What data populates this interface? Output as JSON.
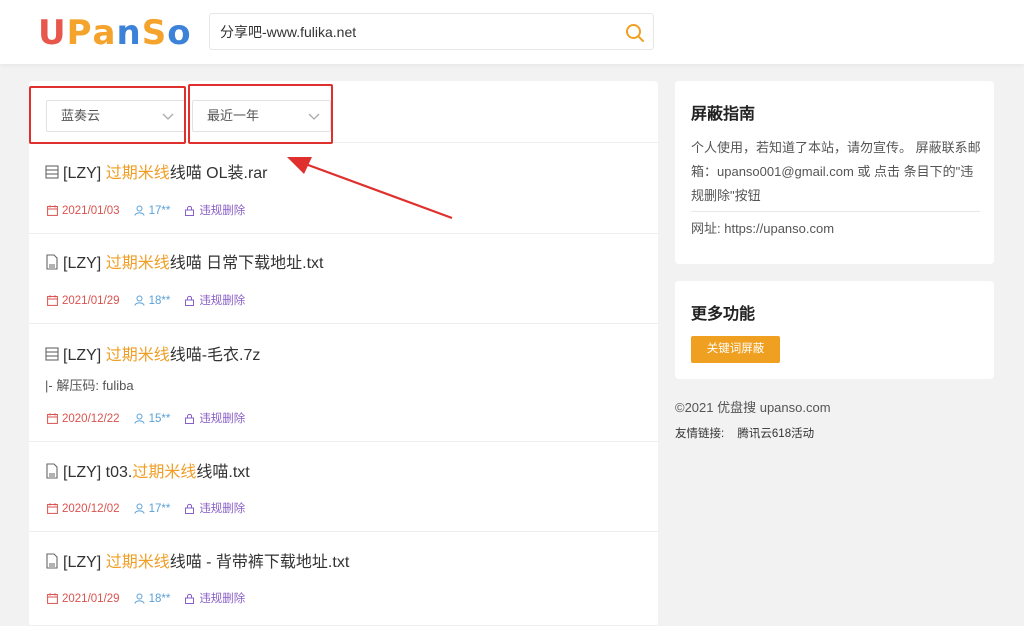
{
  "header": {
    "logo": [
      {
        "ch": "U",
        "color": "#e8574c"
      },
      {
        "ch": "P",
        "color": "#f4a32c"
      },
      {
        "ch": "a",
        "color": "#f4a32c"
      },
      {
        "ch": "n",
        "color": "#3b82d8"
      },
      {
        "ch": "S",
        "color": "#f4a32c"
      },
      {
        "ch": "o",
        "color": "#3b82d8"
      }
    ],
    "search_value": "分享吧-www.fulika.net"
  },
  "filters": {
    "source_select": "蓝奏云",
    "time_select": "最近一年"
  },
  "results": [
    {
      "icon": "archive-icon",
      "prefix": "[LZY] ",
      "highlight": "过期米线",
      "suffix": "线喵 OL装.rar",
      "extra": "",
      "date": "2021/01/03",
      "user": "17**",
      "report": "违规删除"
    },
    {
      "icon": "document-icon",
      "prefix": "[LZY] ",
      "highlight": "过期米线",
      "suffix": "线喵 日常下载地址.txt",
      "extra": "",
      "date": "2021/01/29",
      "user": "18**",
      "report": "违规删除"
    },
    {
      "icon": "archive-icon",
      "prefix": "[LZY] ",
      "highlight": "过期米线",
      "suffix": "线喵-毛衣.7z",
      "extra": "|- 解压码: fuliba",
      "date": "2020/12/22",
      "user": "15**",
      "report": "违规删除"
    },
    {
      "icon": "document-icon",
      "prefix": "[LZY] t03.",
      "highlight": "过期米线",
      "suffix": "线喵.txt",
      "extra": "",
      "date": "2020/12/02",
      "user": "17**",
      "report": "违规删除"
    },
    {
      "icon": "document-icon",
      "prefix": "[LZY] ",
      "highlight": "过期米线",
      "suffix": "线喵 - 背带裤下载地址.txt",
      "extra": "",
      "date": "2021/01/29",
      "user": "18**",
      "report": "违规删除"
    }
  ],
  "sidebar": {
    "guide_title": "屏蔽指南",
    "guide_text": "个人使用，若知道了本站，请勿宣传。 屏蔽联系邮箱：upanso001@gmail.com 或 点击 条目下的\"违规删除\"按钮",
    "guide_url": "网址: https://upanso.com",
    "more_title": "更多功能",
    "keyword_button": "关键词屏蔽"
  },
  "footer": {
    "copyright": "©2021 优盘搜 upanso.com",
    "links_label": "友情链接:",
    "links": [
      "腾讯云618活动"
    ]
  },
  "colors": {
    "highlight": "#ef9f27",
    "annotation_red": "#e0302d",
    "button_orange": "#f0a020"
  }
}
